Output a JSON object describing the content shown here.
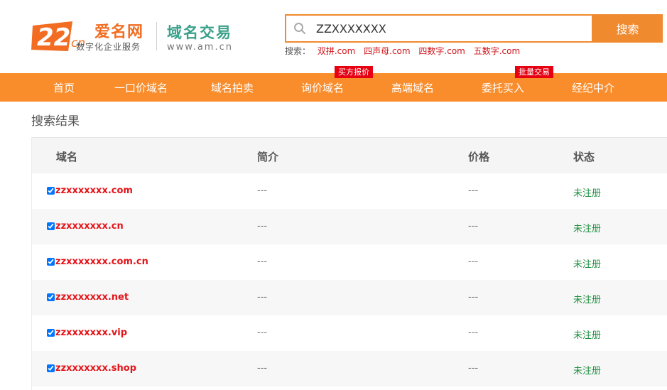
{
  "logo": {
    "mark_text": "22",
    "mark_sub": "cn",
    "name": "爱名网",
    "tagline": "数字化企业服务"
  },
  "site": {
    "title": "域名交易",
    "url": "www.am.cn"
  },
  "search": {
    "value": "ZZXXXXXXX",
    "button_label": "搜索",
    "icon": "search-icon"
  },
  "quick_search": {
    "label": "搜索：",
    "links": [
      "双拼.com",
      "四声母.com",
      "四数字.com",
      "五数字.com"
    ]
  },
  "nav": {
    "items": [
      "首页",
      "一口价域名",
      "域名拍卖",
      "询价域名",
      "高端域名",
      "委托买入",
      "经纪中介"
    ],
    "badges": [
      "买方报价",
      "批量交易"
    ]
  },
  "results": {
    "heading": "搜索结果",
    "columns": [
      "域名",
      "简介",
      "价格",
      "状态"
    ],
    "rows": [
      {
        "domain": "zzxxxxxxx.com",
        "intro": "---",
        "price": "---",
        "status": "未注册"
      },
      {
        "domain": "zzxxxxxxx.cn",
        "intro": "---",
        "price": "---",
        "status": "未注册"
      },
      {
        "domain": "zzxxxxxxx.com.cn",
        "intro": "---",
        "price": "---",
        "status": "未注册"
      },
      {
        "domain": "zzxxxxxxx.net",
        "intro": "---",
        "price": "---",
        "status": "未注册"
      },
      {
        "domain": "zzxxxxxxx.vip",
        "intro": "---",
        "price": "---",
        "status": "未注册"
      },
      {
        "domain": "zzxxxxxxx.shop",
        "intro": "---",
        "price": "---",
        "status": "未注册"
      }
    ]
  },
  "colors": {
    "accent": "#f98d2c",
    "domain_red": "#e3141a",
    "status_green": "#1e8f3f",
    "badge_red": "#e60012"
  }
}
